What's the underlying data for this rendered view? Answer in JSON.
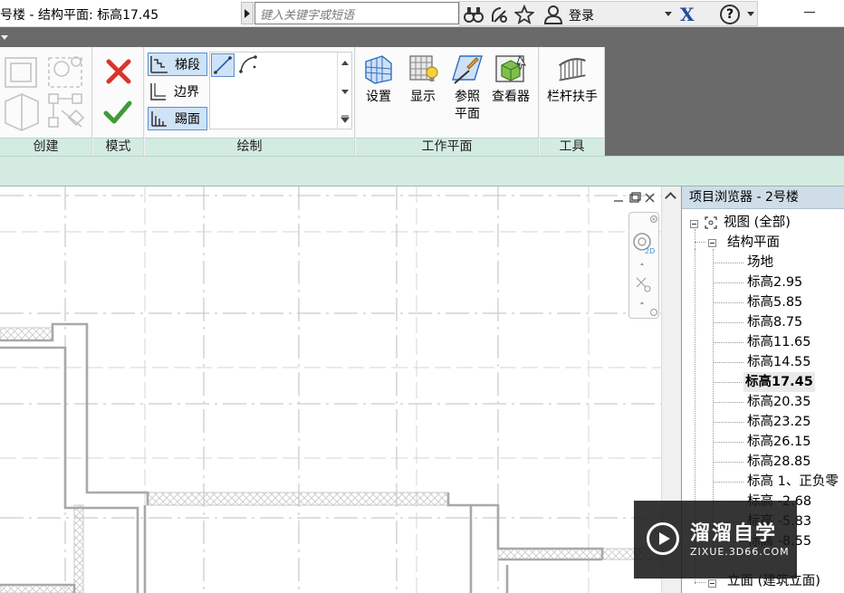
{
  "window": {
    "title": "号楼 - 结构平面: 标高17.45"
  },
  "search": {
    "placeholder": "键入关键字或短语"
  },
  "infocenter": {
    "login_label": "登录",
    "help_label": "?",
    "brand_glyph": "X"
  },
  "ribbon": {
    "panels": {
      "create": "创建",
      "mode": "模式",
      "draw": "绘制",
      "workplane": "工作平面",
      "tools": "工具"
    },
    "draw_tools": {
      "run": "梯段",
      "boundary": "边界",
      "riser": "踢面"
    },
    "workplane_buttons": {
      "set": "设置",
      "show": "显示",
      "ref_plane_1": "参照",
      "ref_plane_2": "平面",
      "viewer": "查看器"
    },
    "tools_buttons": {
      "railing": "栏杆扶手"
    }
  },
  "browser": {
    "title": "项目浏览器 - 2号楼",
    "root": "视图 (全部)",
    "group": "结构平面",
    "levels": [
      "场地",
      "标高2.95",
      "标高5.85",
      "标高8.75",
      "标高11.65",
      "标高14.55",
      "标高17.45",
      "标高20.35",
      "标高23.25",
      "标高26.15",
      "标高28.85",
      "标高 1、正负零",
      "标高 -2.68",
      "标高 -5.83",
      "标高 -8.55"
    ],
    "active_level": "标高17.45",
    "elevation_group": "立面 (建筑立面)"
  },
  "watermark": {
    "title": "溜溜自学",
    "url": "ZIXUE.3D66.COM"
  },
  "colors": {
    "ribbon_label_bg": "#d4ebe2",
    "browser_title_bg": "#cfdde8",
    "tab_strip": "#6a6a6a",
    "cancel_red": "#d9342b",
    "finish_green": "#3e9b36",
    "wall_stroke": "#a8a8a8"
  }
}
